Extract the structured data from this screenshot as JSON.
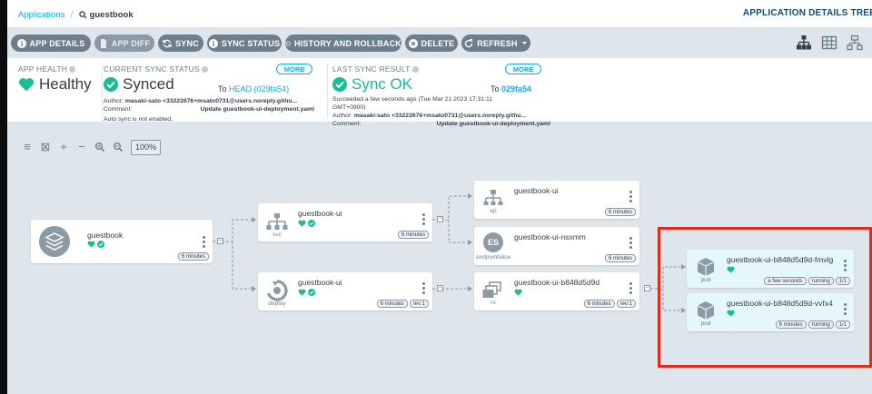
{
  "breadcrumb": {
    "root": "Applications",
    "current": "guestbook"
  },
  "page_title": "APPLICATION DETAILS TREE",
  "toolbar": {
    "app_details": "APP DETAILS",
    "app_diff": "APP DIFF",
    "sync": "SYNC",
    "sync_status": "SYNC STATUS",
    "history": "HISTORY AND ROLLBACK",
    "delete": "DELETE",
    "refresh": "REFRESH"
  },
  "health": {
    "label": "APP HEALTH",
    "value": "Healthy"
  },
  "sync_status": {
    "label": "CURRENT SYNC STATUS",
    "value": "Synced",
    "more": "MORE",
    "to_prefix": "To",
    "revision": "HEAD (029fa54)",
    "author_label": "Author:",
    "author": "masaki-sato <33222676+msato0731@users.noreply.githu...",
    "comment_label": "Comment:",
    "comment": "Update guestbook-ui-deployment.yaml",
    "auto_sync": "Auto sync is not enabled."
  },
  "last_sync": {
    "label": "LAST SYNC RESULT",
    "value": "Sync OK",
    "more": "MORE",
    "to_prefix": "To",
    "revision": "029fa54",
    "succeeded": "Succeeded a few seconds ago (Tue Mar 21 2023 17:31:11",
    "gmt": "GMT+0900)",
    "author_label": "Author:",
    "author": "masaki-sato <33222676+msato0731@users.noreply.githu...",
    "comment_label": "Comment:",
    "comment": "Update guestbook-ui-deployment.yaml"
  },
  "zoom": {
    "level": "100%"
  },
  "nodes": {
    "app": {
      "name": "guestbook",
      "age": "6 minutes"
    },
    "svc": {
      "kind": "svc",
      "name": "guestbook-ui",
      "age": "6 minutes"
    },
    "deploy": {
      "kind": "deploy",
      "name": "guestbook-ui",
      "age": "6 minutes",
      "rev": "rev:1"
    },
    "ep": {
      "kind": "ep",
      "name": "guestbook-ui",
      "age": "6 minutes"
    },
    "endpointslice": {
      "kind": "endpointslice",
      "badge": "ES",
      "name": "guestbook-ui-nsxmm",
      "age": "6 minutes"
    },
    "rs": {
      "kind": "rs",
      "name": "guestbook-ui-b848d5d9d",
      "age": "6 minutes",
      "rev": "rev:1"
    },
    "pod1": {
      "kind": "pod",
      "name": "guestbook-ui-b848d5d9d-fmvlg",
      "age": "a few seconds",
      "state": "running",
      "ready": "1/1"
    },
    "pod2": {
      "kind": "pod",
      "name": "guestbook-ui-b848d5d9d-vvfx4",
      "age": "6 minutes",
      "state": "running",
      "ready": "1/1"
    }
  },
  "colors": {
    "accent": "#0dadea",
    "healthy": "#18be94",
    "highlight": "#e5291c",
    "toolbar_button": "#6d7f8b"
  }
}
